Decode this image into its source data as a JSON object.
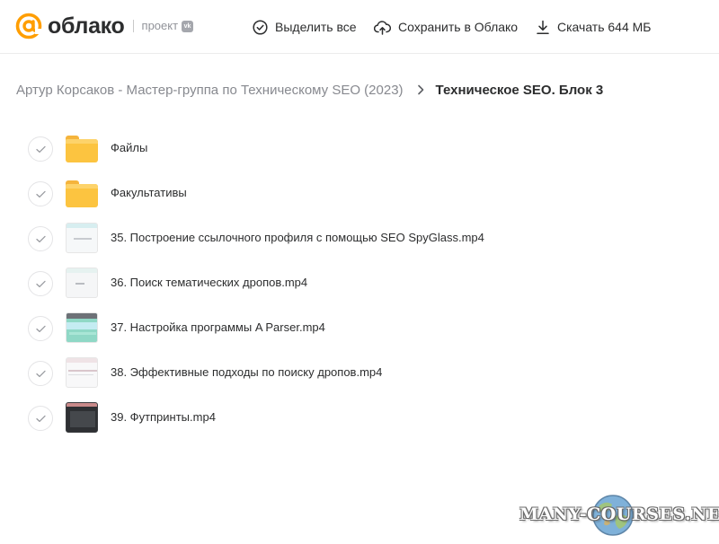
{
  "header": {
    "logo_text": "облако",
    "project_label": "проект",
    "vk_badge": "vk",
    "toolbar": {
      "select_all": "Выделить все",
      "save_to_cloud": "Сохранить в Облако",
      "download": "Скачать 644 МБ"
    }
  },
  "colors": {
    "accent": "#FF9E00",
    "folder": "#FCC440",
    "text": "#2C2D2E",
    "muted": "#87898F"
  },
  "breadcrumb": {
    "parent": "Артур Корсаков - Мастер-группа по Техническому SEO (2023)",
    "current": "Техническое SEO. Блок 3"
  },
  "files": [
    {
      "name": "Файлы",
      "type": "folder",
      "icon": "folder-icon"
    },
    {
      "name": "Факультативы",
      "type": "folder",
      "icon": "folder-icon"
    },
    {
      "name": "35. Построение ссылочного профиля с помощью SEO SpyGlass.mp4",
      "type": "video",
      "icon": "video-thumbnail"
    },
    {
      "name": "36. Поиск тематических дропов.mp4",
      "type": "video",
      "icon": "video-thumbnail"
    },
    {
      "name": "37. Настройка программы A Parser.mp4",
      "type": "video",
      "icon": "video-thumbnail"
    },
    {
      "name": "38. Эффективные подходы по поиску дропов.mp4",
      "type": "video",
      "icon": "video-thumbnail"
    },
    {
      "name": "39. Футпринты.mp4",
      "type": "video",
      "icon": "video-thumbnail"
    }
  ],
  "watermark": "MANY-COURSES.NET"
}
